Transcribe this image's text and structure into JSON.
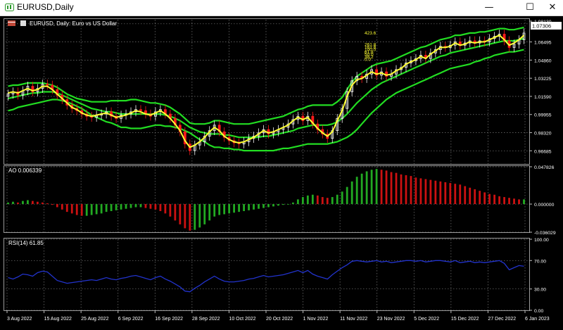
{
  "window": {
    "title": "EURUSD,Daily",
    "minimize_glyph": "—",
    "maximize_glyph": "☐",
    "close_glyph": "✕"
  },
  "chart_header": "EURUSD, Daily:  Euro vs US Dollar",
  "current_price": "1.07306",
  "colors": {
    "background": "#000000",
    "grid": "#7a7a7a",
    "bull_candle": "#f4f4f4",
    "bear_candle": "#ff1a1a",
    "fast_ma": "#ffff33",
    "envelope": "#22dd22",
    "ao_up": "#22aa22",
    "ao_down": "#cc1111",
    "rsi_line": "#2233cc",
    "text": "#ffffff"
  },
  "fib_labels": [
    "423.6",
    "261.8",
    "161.8",
    "100.0",
    "61.8",
    "50.0",
    "38.2",
    "0.0"
  ],
  "panels": {
    "ao": {
      "label": "AO 0.006339",
      "ticks": [
        "0.047826",
        "0.000000",
        "-0.036029"
      ]
    },
    "rsi": {
      "label": "RSI(14) 61.85",
      "ticks": [
        "100.00",
        "70.00",
        "30.00",
        "0.00"
      ]
    }
  },
  "chart_data": [
    {
      "type": "line",
      "name": "price",
      "y_ticks": [
        "1.08130",
        "1.06495",
        "1.04860",
        "1.03225",
        "1.01590",
        "0.99955",
        "0.98320",
        "0.96685"
      ],
      "ylim": [
        0.955,
        1.085
      ],
      "x_ticks": [
        "3 Aug 2022",
        "15 Aug 2022",
        "25 Aug 2022",
        "6 Sep 2022",
        "16 Sep 2022",
        "28 Sep 2022",
        "10 Oct 2022",
        "20 Oct 2022",
        "1 Nov 2022",
        "11 Nov 2022",
        "23 Nov 2022",
        "5 Dec 2022",
        "15 Dec 2022",
        "27 Dec 2022",
        "6 Jan 2023"
      ],
      "closes": [
        1.018,
        1.02,
        1.017,
        1.021,
        1.025,
        1.02,
        1.023,
        1.027,
        1.026,
        1.022,
        1.017,
        1.013,
        1.008,
        1.005,
        1.003,
        1.0,
        0.998,
        0.997,
        0.999,
        1.0,
        1.002,
        0.998,
        0.996,
        0.999,
        1.0,
        1.002,
        1.004,
        1.003,
        1.0,
        0.998,
        1.002,
        1.004,
        1.0,
        0.996,
        0.99,
        0.984,
        0.973,
        0.967,
        0.972,
        0.975,
        0.98,
        0.985,
        0.99,
        0.984,
        0.979,
        0.976,
        0.974,
        0.973,
        0.975,
        0.978,
        0.98,
        0.983,
        0.986,
        0.982,
        0.984,
        0.986,
        0.988,
        0.991,
        0.995,
        0.998,
        0.994,
        0.998,
        0.991,
        0.986,
        0.982,
        0.978,
        0.985,
        0.996,
        1.005,
        1.02,
        1.03,
        1.034,
        1.032,
        1.036,
        1.04,
        1.035,
        1.038,
        1.034,
        1.036,
        1.04,
        1.042,
        1.046,
        1.048,
        1.05,
        1.053,
        1.05,
        1.055,
        1.058,
        1.061,
        1.06,
        1.062,
        1.065,
        1.062,
        1.064,
        1.066,
        1.064,
        1.066,
        1.065,
        1.068,
        1.07,
        1.072,
        1.066,
        1.06,
        1.063,
        1.067,
        1.073
      ],
      "fast_ma": [
        1.019,
        1.02,
        1.019,
        1.021,
        1.023,
        1.021,
        1.022,
        1.025,
        1.025,
        1.022,
        1.018,
        1.014,
        1.01,
        1.006,
        1.004,
        1.001,
        0.999,
        0.998,
        0.999,
        1.0,
        1.001,
        0.999,
        0.997,
        0.998,
        0.999,
        1.001,
        1.003,
        1.002,
        1.0,
        0.999,
        1.001,
        1.003,
        1.0,
        0.996,
        0.991,
        0.985,
        0.976,
        0.97,
        0.972,
        0.975,
        0.979,
        0.984,
        0.988,
        0.985,
        0.98,
        0.977,
        0.975,
        0.974,
        0.975,
        0.977,
        0.979,
        0.982,
        0.985,
        0.983,
        0.984,
        0.986,
        0.988,
        0.99,
        0.994,
        0.997,
        0.995,
        0.997,
        0.992,
        0.987,
        0.983,
        0.98,
        0.984,
        0.994,
        1.003,
        1.016,
        1.026,
        1.031,
        1.032,
        1.035,
        1.038,
        1.036,
        1.037,
        1.035,
        1.036,
        1.039,
        1.041,
        1.045,
        1.047,
        1.049,
        1.052,
        1.05,
        1.054,
        1.057,
        1.06,
        1.06,
        1.061,
        1.064,
        1.062,
        1.063,
        1.065,
        1.064,
        1.065,
        1.065,
        1.067,
        1.069,
        1.071,
        1.067,
        1.062,
        1.064,
        1.067,
        1.071
      ],
      "envelope_upper": [
        1.025,
        1.026,
        1.026,
        1.027,
        1.028,
        1.028,
        1.028,
        1.028,
        1.027,
        1.026,
        1.024,
        1.021,
        1.018,
        1.016,
        1.014,
        1.013,
        1.012,
        1.011,
        1.011,
        1.011,
        1.011,
        1.012,
        1.012,
        1.012,
        1.012,
        1.013,
        1.013,
        1.012,
        1.011,
        1.01,
        1.01,
        1.009,
        1.008,
        1.006,
        1.003,
        1.0,
        0.996,
        0.992,
        0.991,
        0.991,
        0.991,
        0.992,
        0.994,
        0.994,
        0.993,
        0.992,
        0.991,
        0.991,
        0.991,
        0.991,
        0.992,
        0.993,
        0.994,
        0.995,
        0.996,
        0.997,
        0.998,
        1.0,
        1.002,
        1.004,
        1.005,
        1.007,
        1.008,
        1.008,
        1.008,
        1.008,
        1.008,
        1.011,
        1.015,
        1.022,
        1.029,
        1.034,
        1.037,
        1.04,
        1.043,
        1.045,
        1.046,
        1.047,
        1.048,
        1.05,
        1.052,
        1.054,
        1.056,
        1.058,
        1.06,
        1.061,
        1.063,
        1.065,
        1.067,
        1.068,
        1.069,
        1.071,
        1.071,
        1.072,
        1.073,
        1.073,
        1.074,
        1.074,
        1.075,
        1.076,
        1.077,
        1.077,
        1.076,
        1.076,
        1.077,
        1.078
      ],
      "envelope_mid": [
        1.014,
        1.015,
        1.016,
        1.017,
        1.018,
        1.019,
        1.019,
        1.02,
        1.02,
        1.02,
        1.019,
        1.017,
        1.015,
        1.013,
        1.011,
        1.009,
        1.007,
        1.005,
        1.004,
        1.003,
        1.002,
        1.002,
        1.001,
        1.0,
        1.0,
        1.0,
        1.0,
        1.0,
        1.0,
        1.0,
        1.0,
        1.0,
        0.999,
        0.998,
        0.996,
        0.994,
        0.991,
        0.988,
        0.986,
        0.984,
        0.983,
        0.982,
        0.982,
        0.982,
        0.981,
        0.981,
        0.98,
        0.979,
        0.979,
        0.979,
        0.979,
        0.979,
        0.98,
        0.98,
        0.981,
        0.982,
        0.983,
        0.984,
        0.985,
        0.987,
        0.988,
        0.989,
        0.99,
        0.99,
        0.99,
        0.99,
        0.991,
        0.993,
        0.996,
        1.0,
        1.005,
        1.01,
        1.014,
        1.018,
        1.022,
        1.025,
        1.028,
        1.03,
        1.032,
        1.034,
        1.036,
        1.038,
        1.04,
        1.042,
        1.044,
        1.046,
        1.048,
        1.05,
        1.052,
        1.053,
        1.055,
        1.056,
        1.057,
        1.058,
        1.059,
        1.06,
        1.061,
        1.062,
        1.063,
        1.064,
        1.065,
        1.066,
        1.066,
        1.066,
        1.067,
        1.068
      ],
      "envelope_lower": [
        1.003,
        1.004,
        1.006,
        1.007,
        1.008,
        1.009,
        1.01,
        1.011,
        1.012,
        1.013,
        1.013,
        1.012,
        1.011,
        1.009,
        1.007,
        1.005,
        1.002,
        0.999,
        0.997,
        0.995,
        0.993,
        0.992,
        0.99,
        0.988,
        0.988,
        0.987,
        0.987,
        0.987,
        0.988,
        0.989,
        0.99,
        0.99,
        0.989,
        0.989,
        0.988,
        0.987,
        0.985,
        0.983,
        0.98,
        0.977,
        0.975,
        0.972,
        0.97,
        0.97,
        0.969,
        0.969,
        0.968,
        0.968,
        0.967,
        0.967,
        0.967,
        0.967,
        0.967,
        0.967,
        0.967,
        0.968,
        0.969,
        0.969,
        0.97,
        0.971,
        0.972,
        0.973,
        0.973,
        0.973,
        0.973,
        0.973,
        0.974,
        0.975,
        0.977,
        0.979,
        0.982,
        0.986,
        0.991,
        0.996,
        1.001,
        1.005,
        1.009,
        1.013,
        1.016,
        1.019,
        1.021,
        1.023,
        1.025,
        1.027,
        1.029,
        1.031,
        1.033,
        1.035,
        1.037,
        1.039,
        1.041,
        1.042,
        1.043,
        1.044,
        1.045,
        1.047,
        1.048,
        1.05,
        1.051,
        1.053,
        1.054,
        1.055,
        1.056,
        1.056,
        1.057,
        1.058
      ]
    },
    {
      "type": "bar",
      "name": "AO",
      "ylim": [
        -0.036029,
        0.047826
      ],
      "values": [
        0.002,
        0.003,
        0.002,
        0.004,
        0.005,
        0.004,
        0.003,
        0.002,
        0.001,
        -0.001,
        -0.004,
        -0.007,
        -0.01,
        -0.012,
        -0.014,
        -0.015,
        -0.015,
        -0.014,
        -0.013,
        -0.012,
        -0.01,
        -0.009,
        -0.008,
        -0.007,
        -0.006,
        -0.005,
        -0.004,
        -0.004,
        -0.005,
        -0.006,
        -0.007,
        -0.009,
        -0.012,
        -0.016,
        -0.021,
        -0.026,
        -0.031,
        -0.034,
        -0.033,
        -0.03,
        -0.026,
        -0.021,
        -0.016,
        -0.014,
        -0.013,
        -0.012,
        -0.011,
        -0.01,
        -0.009,
        -0.008,
        -0.007,
        -0.006,
        -0.005,
        -0.004,
        -0.003,
        -0.002,
        -0.001,
        0.0,
        0.002,
        0.006,
        0.009,
        0.011,
        0.012,
        0.011,
        0.009,
        0.008,
        0.009,
        0.012,
        0.016,
        0.022,
        0.029,
        0.035,
        0.039,
        0.042,
        0.044,
        0.045,
        0.044,
        0.043,
        0.041,
        0.04,
        0.038,
        0.037,
        0.036,
        0.034,
        0.033,
        0.032,
        0.031,
        0.03,
        0.029,
        0.028,
        0.027,
        0.026,
        0.025,
        0.023,
        0.021,
        0.019,
        0.017,
        0.015,
        0.013,
        0.012,
        0.01,
        0.009,
        0.008,
        0.007,
        0.006,
        0.006
      ]
    },
    {
      "type": "line",
      "name": "RSI(14)",
      "ylim": [
        0,
        100
      ],
      "values": [
        46,
        44,
        47,
        51,
        50,
        48,
        53,
        55,
        54,
        48,
        42,
        40,
        38,
        39,
        40,
        41,
        42,
        43,
        42,
        44,
        46,
        44,
        43,
        45,
        46,
        48,
        49,
        47,
        45,
        43,
        46,
        48,
        44,
        41,
        37,
        33,
        27,
        26,
        31,
        35,
        40,
        44,
        48,
        44,
        41,
        40,
        40,
        41,
        42,
        44,
        45,
        47,
        49,
        47,
        48,
        49,
        50,
        52,
        54,
        56,
        53,
        56,
        51,
        48,
        46,
        44,
        50,
        55,
        60,
        64,
        69,
        70,
        69,
        68,
        69,
        70,
        68,
        69,
        67,
        68,
        69,
        70,
        70,
        69,
        70,
        68,
        69,
        70,
        70,
        69,
        68,
        70,
        67,
        68,
        69,
        67,
        68,
        67,
        68,
        69,
        70,
        66,
        57,
        60,
        63,
        62
      ]
    }
  ]
}
